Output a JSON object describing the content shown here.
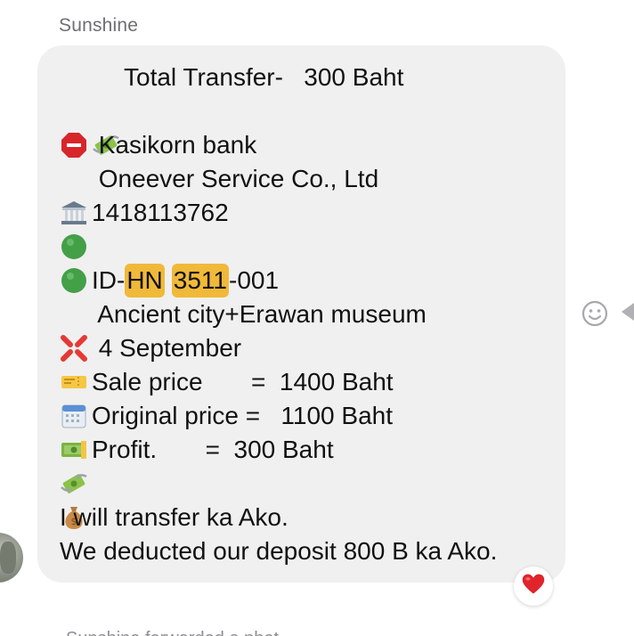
{
  "sender": {
    "name": "Sunshine"
  },
  "message": {
    "lines": [
      {
        "icons": [
          "stop-sign-icon",
          "money-with-wings-icon"
        ],
        "text": "Total Transfer-   300 Baht"
      },
      {
        "icons": [
          "bank-icon"
        ],
        "text": " Kasikorn bank"
      },
      {
        "icons": [
          "green-circle-icon"
        ],
        "text": " Oneever Service Co., Ltd"
      },
      {
        "icons": [
          "green-circle-icon"
        ],
        "text": "1418113762"
      },
      {
        "icons": [
          "anger-symbol-icon"
        ],
        "id_prefix": "ID-",
        "id_hl_1": "HN",
        "id_hl_2": "3511",
        "id_suffix": "-001"
      },
      {
        "icons": [
          "ticket-icon"
        ],
        "text": " Ancient city+Erawan museum"
      },
      {
        "icons": [
          "calendar-icon"
        ],
        "text": " 4 September"
      },
      {
        "icons": [
          "banknote-icon"
        ],
        "text": "Sale price       =  1400 Baht"
      },
      {
        "icons": [
          "money-with-wings-icon"
        ],
        "text": "Original price =   1100 Baht"
      },
      {
        "icons": [
          "money-bag-icon"
        ],
        "text": "Profit.       =  300 Baht"
      },
      {
        "text": "I will transfer ka Ako."
      },
      {
        "text": "We deducted our deposit 800 B ka Ako."
      }
    ]
  },
  "reaction": {
    "icon": "heart-icon",
    "color": "#e0242b"
  },
  "next_message_partial": "Sunshine forwarded a phot"
}
